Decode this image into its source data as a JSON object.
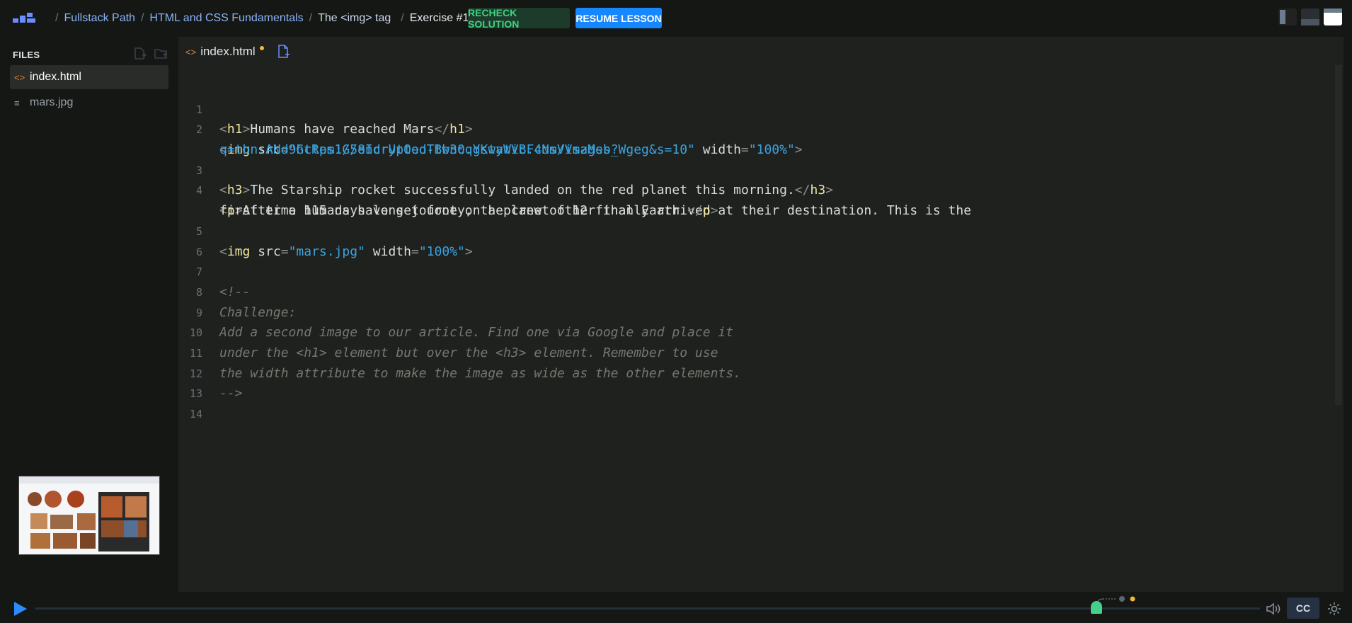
{
  "breadcrumbs": [
    {
      "label": "Fullstack Path"
    },
    {
      "label": "HTML and CSS Fundamentals"
    },
    {
      "label": "The <img> tag"
    },
    {
      "label": "Exercise #1"
    }
  ],
  "buttons": {
    "recheck": "RECHECK SOLUTION",
    "resume": "RESUME LESSON",
    "cc": "CC"
  },
  "sidebar": {
    "heading": "FILES",
    "files": [
      {
        "name": "index.html",
        "icon": "html-file-icon",
        "active": true
      },
      {
        "name": "mars.jpg",
        "icon": "image-file-icon",
        "active": false
      }
    ]
  },
  "editor": {
    "tab_label": "index.html",
    "unsaved": true,
    "line_numbers": [
      "1",
      "2",
      "3",
      "4",
      "5",
      "6",
      "7",
      "8",
      "9",
      "10",
      "11",
      "12",
      "13",
      "14"
    ],
    "code": {
      "l1_open": "h1",
      "l1_text": "Humans have reached Mars",
      "l1_close": "h1",
      "l2_tag": "img",
      "l2_attr_src": "src",
      "l2_src_part1": "\"https://encrypted-tbn0.gstatic.com/images?",
      "l2_src_part2": "q=tbn:ANd9GcRem1G58IdrUtOooTBw3cqYKwyWVBF4NsVVszMsb_Wgeg&s=10\"",
      "l2_attr_width": "width",
      "l2_width_val": "\"100%\"",
      "l3_open": "h3",
      "l3_text": "The Starship rocket successfully landed on the red planet this morning.",
      "l3_close": "h3",
      "l4_open": "p",
      "l4_text_part1": "After a 115 days long journey, the crew of 12 finally arrived at their destination. This is the",
      "l4_text_part2": "first time humans have set foot on a planet other than Earth.",
      "l4_close": "p",
      "l5_tag": "img",
      "l5_attr_src": "src",
      "l5_src": "\"mars.jpg\"",
      "l5_attr_width": "width",
      "l5_width_val": "\"100%\"",
      "comment": [
        "<!--",
        "Challenge:",
        "Add a second image to our article. Find one via Google and place it",
        "under the <h1> element but over the <h3> element. Remember to use",
        "the width attribute to make the image as wide as the other elements.",
        "-->"
      ]
    }
  },
  "colors": {
    "accent_blue": "#1787ff",
    "recheck_green": "#3fd27f",
    "string": "#3aa3e0",
    "tag": "#f0e6a0",
    "comment": "#72786f"
  }
}
